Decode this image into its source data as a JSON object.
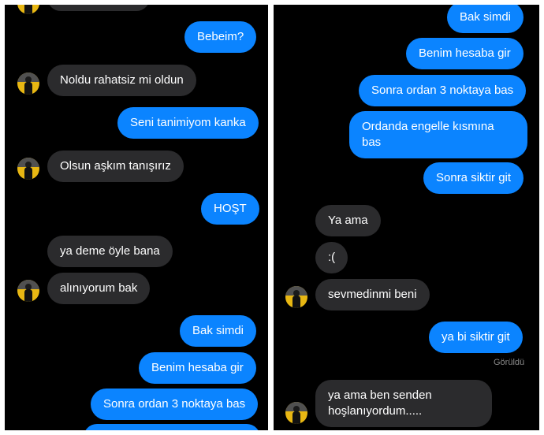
{
  "left_panel": {
    "messages": [
      {
        "dir": "out",
        "text": "Bebeim?"
      },
      {
        "dir": "in",
        "text": "Noldu rahatsiz mi oldun"
      },
      {
        "dir": "out",
        "text": "Seni tanimiyom kanka"
      },
      {
        "dir": "in",
        "text": "Olsun aşkım tanışırız"
      },
      {
        "dir": "out",
        "text": "HOŞT"
      },
      {
        "dir": "in",
        "text": "ya deme öyle bana"
      },
      {
        "dir": "in",
        "text": "alınıyorum bak"
      },
      {
        "dir": "out",
        "text": "Bak simdi"
      },
      {
        "dir": "out",
        "text": "Benim hesaba gir"
      },
      {
        "dir": "out",
        "text": "Sonra ordan 3 noktaya bas"
      }
    ]
  },
  "right_panel": {
    "messages": [
      {
        "dir": "out",
        "text": "Bak simdi"
      },
      {
        "dir": "out",
        "text": "Benim hesaba gir"
      },
      {
        "dir": "out",
        "text": "Sonra ordan 3 noktaya bas"
      },
      {
        "dir": "out",
        "text": "Ordanda engelle kısmına bas"
      },
      {
        "dir": "out",
        "text": "Sonra siktir git"
      },
      {
        "dir": "in",
        "text": "Ya ama"
      },
      {
        "dir": "in",
        "text": ":("
      },
      {
        "dir": "in",
        "text": "sevmedinmi beni"
      },
      {
        "dir": "out",
        "text": "ya bi siktir git"
      },
      {
        "dir": "in",
        "text": "ya ama ben senden hoşlanıyordum....."
      }
    ],
    "seen_label": "Görüldü"
  },
  "colors": {
    "outgoing_bubble": "#0b84ff",
    "incoming_bubble": "#2b2b2d",
    "background": "#000000",
    "avatar": "#e8b713"
  },
  "icons": [
    "avatar-icon"
  ]
}
